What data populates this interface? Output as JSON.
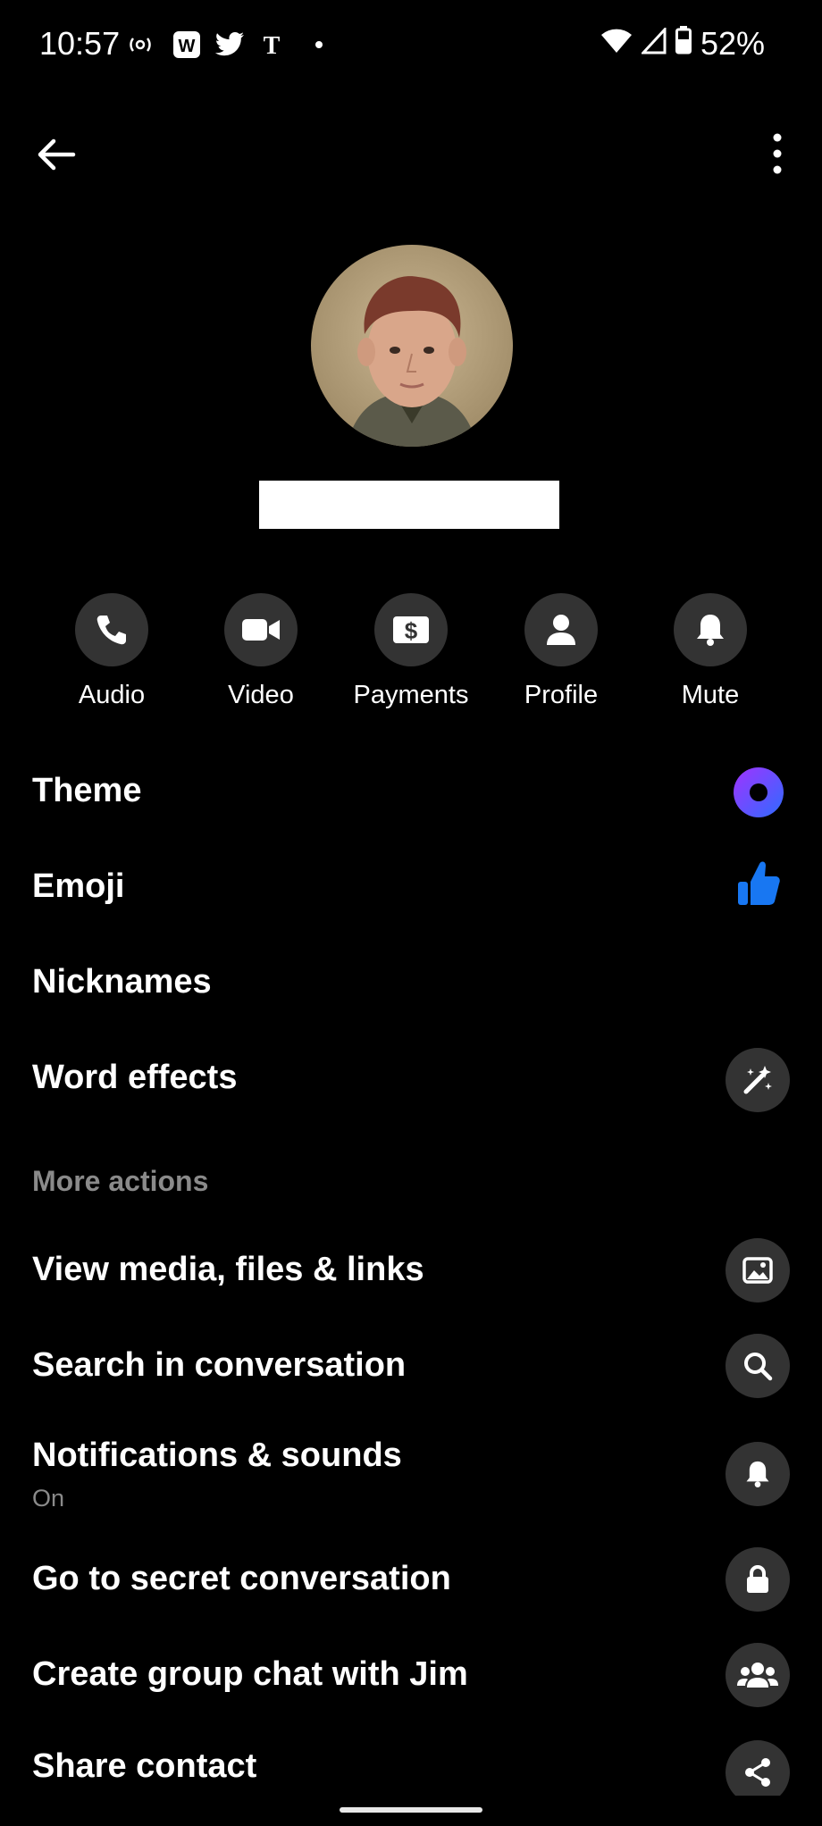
{
  "status_bar": {
    "time": "10:57",
    "battery": "52%",
    "notif_icons": [
      "radio-icon",
      "w-app-icon",
      "twitter-icon",
      "nyt-icon",
      "dot-icon"
    ],
    "system_icons": [
      "wifi-icon",
      "signal-icon",
      "battery-icon"
    ]
  },
  "header": {
    "back_icon": "arrow-left-icon",
    "menu_icon": "more-vertical-icon"
  },
  "quick_actions": [
    {
      "label": "Audio",
      "icon": "phone-icon"
    },
    {
      "label": "Video",
      "icon": "video-icon"
    },
    {
      "label": "Payments",
      "icon": "dollar-icon"
    },
    {
      "label": "Profile",
      "icon": "person-icon"
    },
    {
      "label": "Mute",
      "icon": "bell-icon"
    }
  ],
  "customize": {
    "theme": "Theme",
    "emoji": "Emoji",
    "nicknames": "Nicknames",
    "word_effects": "Word effects"
  },
  "more_actions": {
    "heading": "More actions",
    "view_media": "View media, files & links",
    "search": "Search in conversation",
    "notifications": "Notifications & sounds",
    "notifications_status": "On",
    "secret": "Go to secret conversation",
    "group_chat": "Create group chat with Jim",
    "share_contact": "Share contact"
  },
  "colors": {
    "background": "#000000",
    "icon_circle": "#333333",
    "muted_text": "#8a8a8a",
    "theme_gradient_start": "#a033ff",
    "theme_gradient_end": "#2f6bff",
    "emoji_blue": "#1877f2"
  }
}
